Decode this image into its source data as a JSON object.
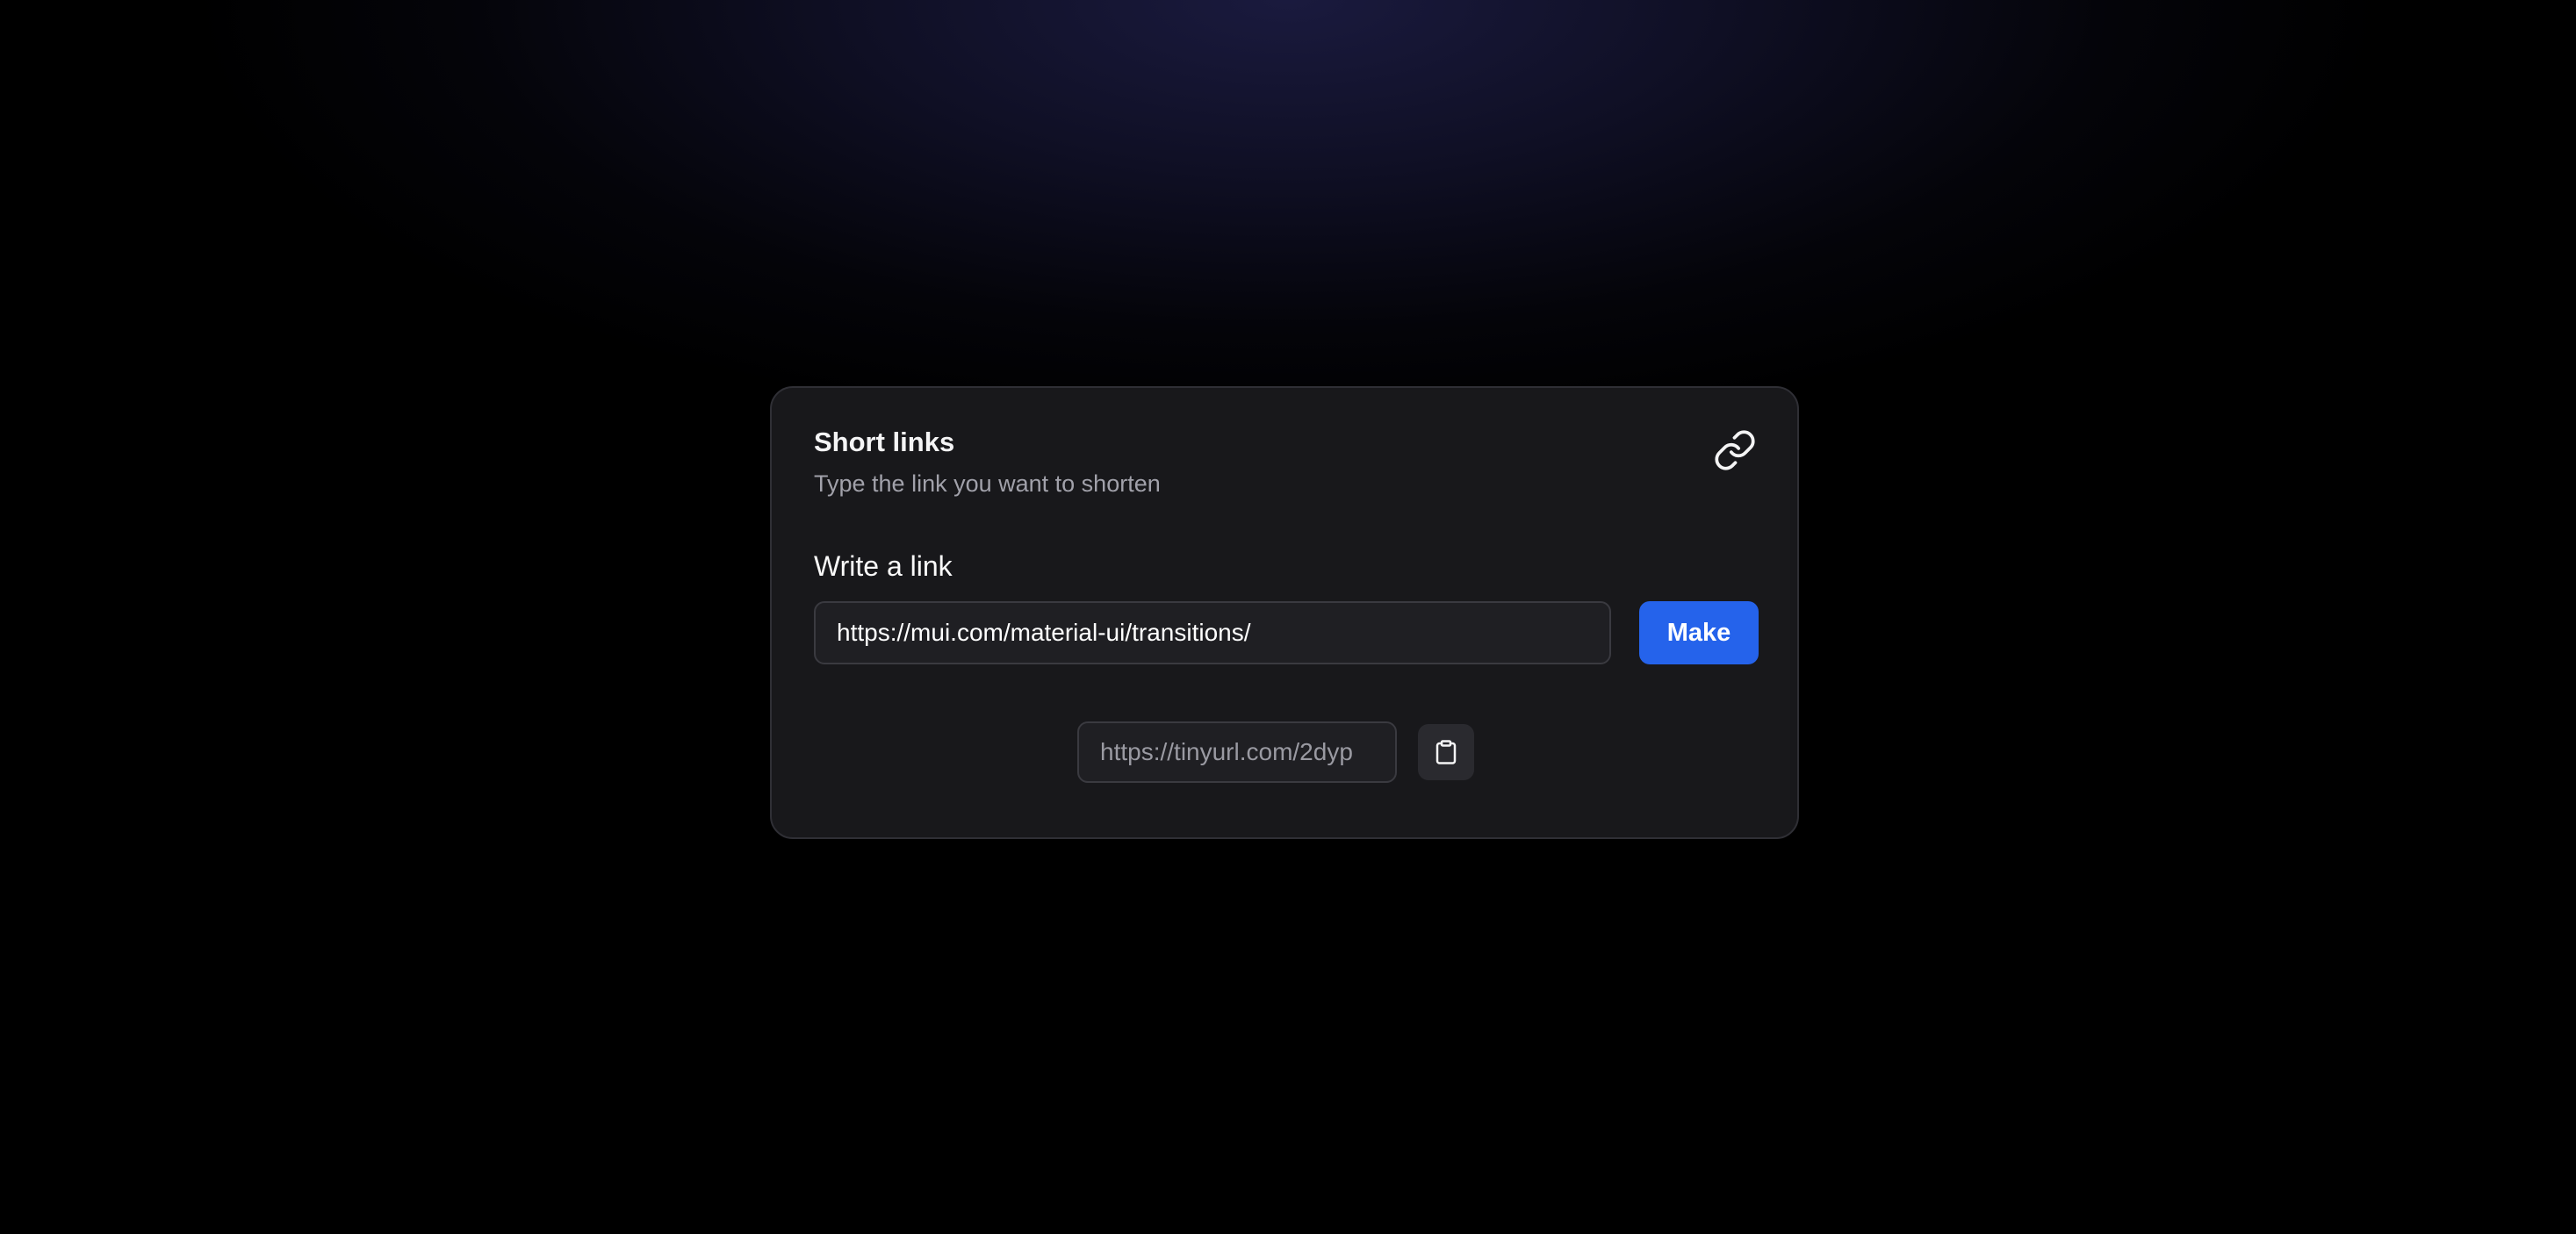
{
  "card": {
    "title": "Short links",
    "subtitle": "Type the link you want to shorten",
    "header_icon": "link-icon"
  },
  "form": {
    "label": "Write a link",
    "url_value": "https://mui.com/material-ui/transitions/",
    "submit_label": "Make"
  },
  "result": {
    "short_url": "https://tinyurl.com/2dyp",
    "copy_icon": "clipboard-icon"
  },
  "colors": {
    "accent": "#2563eb",
    "card_background": "#18181b",
    "page_background": "#000000"
  }
}
